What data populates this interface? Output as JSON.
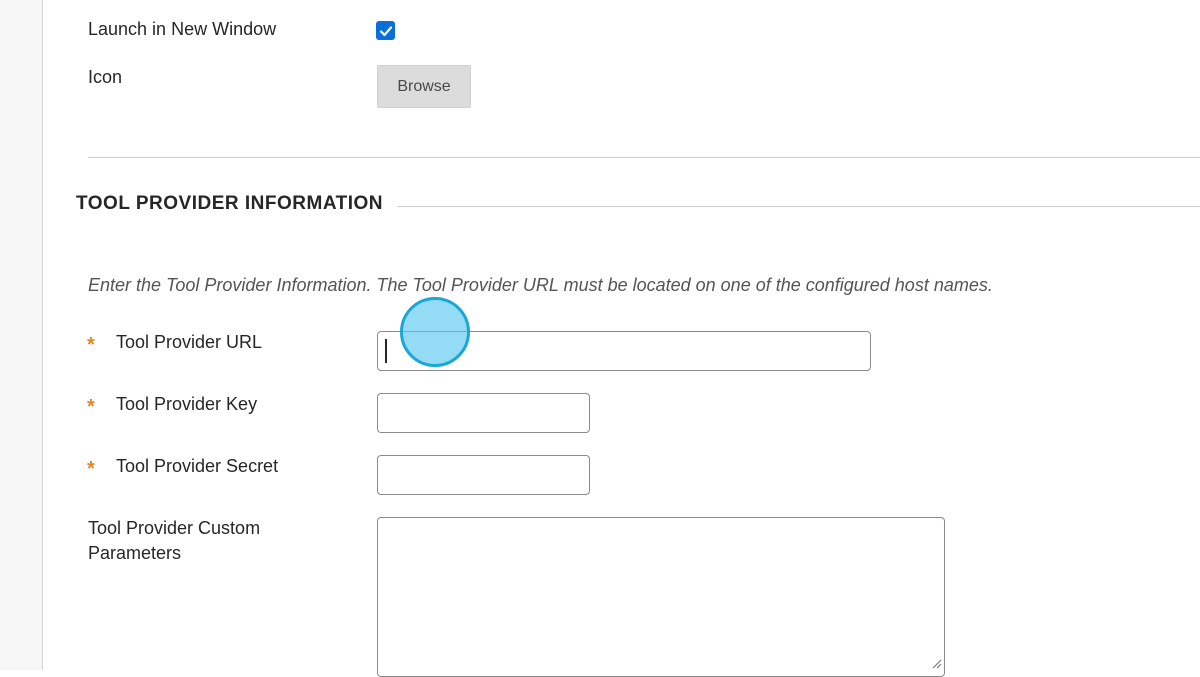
{
  "form": {
    "launch_new_window_label": "Launch in New Window",
    "launch_new_window_checked": true,
    "icon_label": "Icon",
    "browse_label": "Browse"
  },
  "section": {
    "title": "TOOL PROVIDER INFORMATION",
    "instructions": "Enter the Tool Provider Information. The Tool Provider URL must be located on one of the configured host names."
  },
  "fields": {
    "required_marker": "*",
    "url_label": "Tool Provider URL",
    "url_value": "",
    "key_label": "Tool Provider Key",
    "key_value": "",
    "secret_label": "Tool Provider Secret",
    "secret_value": "",
    "custom_params_label_line1": "Tool Provider Custom",
    "custom_params_label_line2": "Parameters",
    "custom_params_value": ""
  },
  "colors": {
    "required_star": "#e0872b",
    "checkbox_accent": "#0a6fd6",
    "click_indicator": "#1aa6d6"
  }
}
